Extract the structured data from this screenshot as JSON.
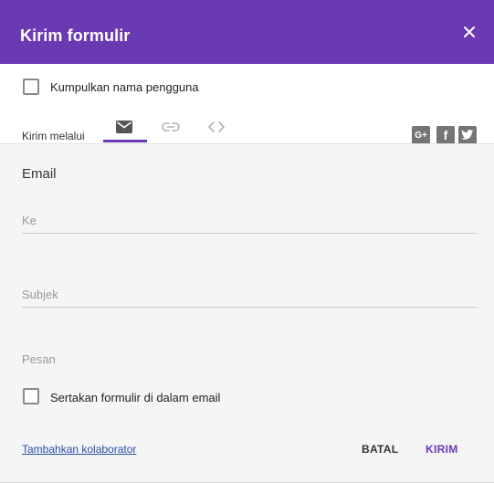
{
  "dialog": {
    "title": "Kirim formulir",
    "close_icon": "close-icon"
  },
  "options": {
    "collect_usernames_label": "Kumpulkan nama pengguna",
    "collect_usernames_checked": false
  },
  "send_via": {
    "label": "Kirim melalui",
    "tabs": [
      {
        "icon": "email-icon",
        "selected": true
      },
      {
        "icon": "link-icon",
        "selected": false
      },
      {
        "icon": "embed-code-icon",
        "selected": false
      }
    ],
    "social": [
      {
        "icon": "google-plus-icon",
        "glyph": "G+"
      },
      {
        "icon": "facebook-icon",
        "glyph": "f"
      },
      {
        "icon": "twitter-icon"
      }
    ]
  },
  "email": {
    "section_title": "Email",
    "to_placeholder": "Ke",
    "subject_placeholder": "Subjek",
    "message_placeholder": "Pesan",
    "include_form_label": "Sertakan formulir di dalam email",
    "include_form_checked": false
  },
  "footer": {
    "add_collaborators": "Tambahkan kolaborator",
    "cancel_label": "BATAL",
    "send_label": "KIRIM"
  },
  "colors": {
    "accent": "#6a3ab3",
    "link": "#2a4ea8"
  }
}
